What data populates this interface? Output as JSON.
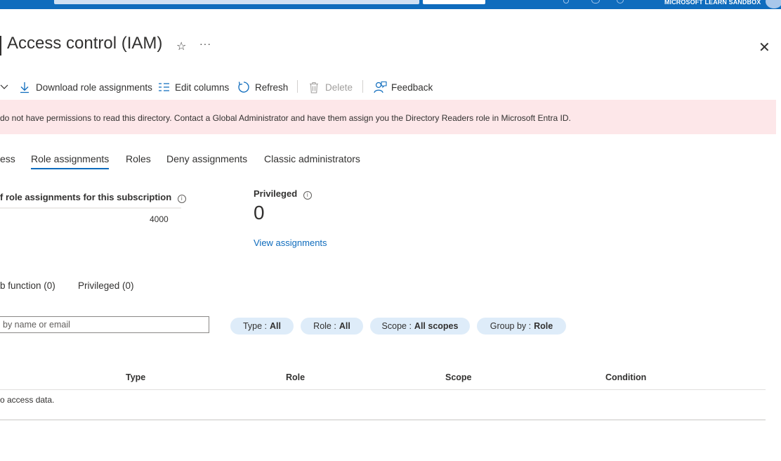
{
  "topbar": {
    "account_label": "MICROSOFT LEARN SANDBOX",
    "color": "#0f6cbd"
  },
  "header": {
    "title": "Access control (IAM)",
    "star_glyph": "☆",
    "more_glyph": "···",
    "close_glyph": "✕"
  },
  "toolbar": {
    "download_label": "Download role assignments",
    "edit_columns_label": "Edit columns",
    "refresh_label": "Refresh",
    "delete_label": "Delete",
    "feedback_label": "Feedback"
  },
  "banner": {
    "text": "do not have permissions to read this directory. Contact a Global Administrator and have them assign you the Directory Readers role in Microsoft Entra ID.",
    "color": "#fde7e9"
  },
  "tabs": [
    {
      "label": "ess",
      "active": false
    },
    {
      "label": "Role assignments",
      "active": true
    },
    {
      "label": "Roles",
      "active": false
    },
    {
      "label": "Deny assignments",
      "active": false
    },
    {
      "label": "Classic administrators",
      "active": false
    }
  ],
  "stats": {
    "assignments_title": "f role assignments for this subscription",
    "assignments_limit": "4000",
    "privileged_title": "Privileged",
    "privileged_count": "0",
    "view_assignments_link": "View assignments"
  },
  "subfilters": [
    {
      "label": "b function (0)"
    },
    {
      "label": "Privileged (0)"
    }
  ],
  "search": {
    "placeholder": "by name or email"
  },
  "pills": [
    {
      "key": "Type :",
      "value": "All"
    },
    {
      "key": "Role :",
      "value": "All"
    },
    {
      "key": "Scope :",
      "value": "All scopes"
    },
    {
      "key": "Group by :",
      "value": "Role"
    }
  ],
  "table": {
    "columns": [
      "Type",
      "Role",
      "Scope",
      "Condition"
    ],
    "empty_message": "o access data."
  },
  "icons": [
    "download-icon",
    "edit-columns-icon",
    "refresh-icon",
    "delete-icon",
    "feedback-icon",
    "star-icon",
    "more-icon",
    "close-icon",
    "info-icon",
    "chevron-down-icon"
  ]
}
